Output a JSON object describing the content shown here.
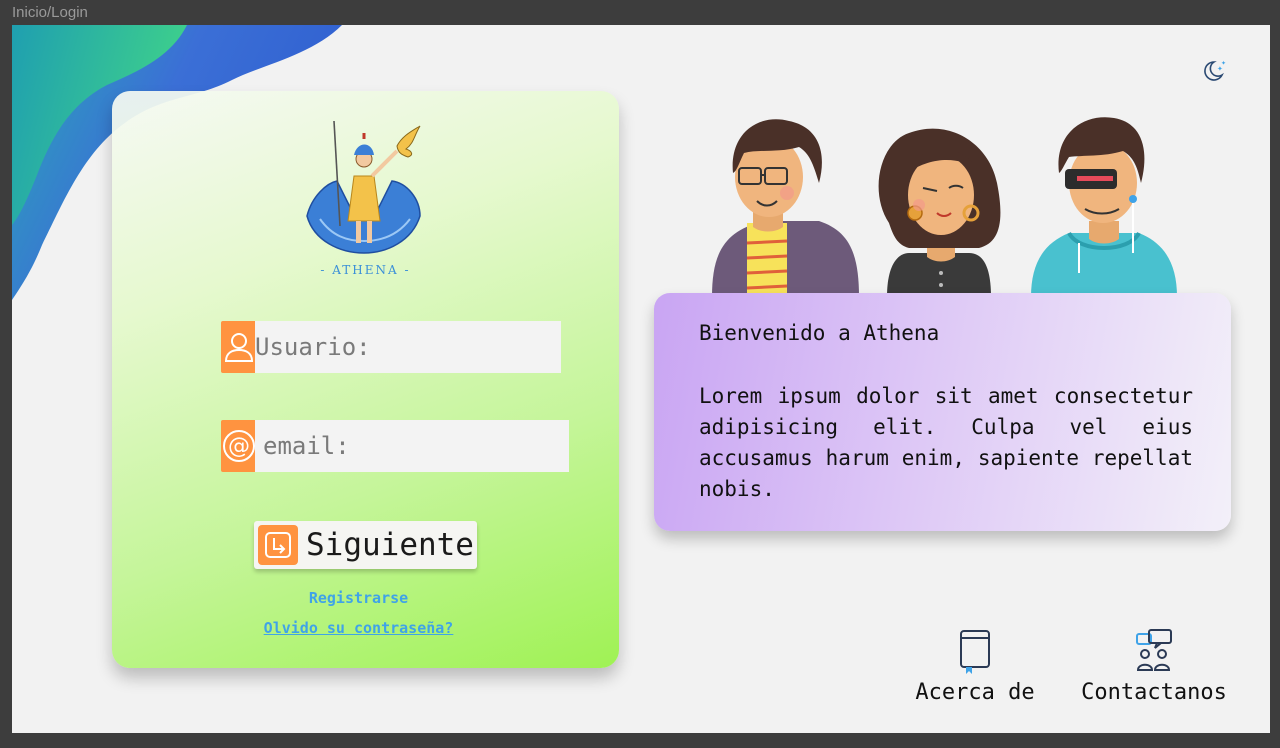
{
  "window": {
    "title": "Inicio/Login"
  },
  "brand": {
    "name": "- ATHENA -"
  },
  "login": {
    "username_placeholder": "Usuario:",
    "email_placeholder": "email:",
    "next_label": "Siguiente",
    "register_link": "Registrarse",
    "forgot_link": "Olvido su contraseña?"
  },
  "welcome": {
    "title": "Bienvenido a Athena",
    "body": "Lorem ipsum dolor sit amet consectetur adipisicing elit. Culpa vel eius accusamus harum enim, sapiente repellat nobis."
  },
  "nav": {
    "about_label": "Acerca de",
    "contact_label": "Contactanos"
  },
  "colors": {
    "accent_orange": "#ff9340",
    "link_blue": "#3fa3e8",
    "card_green": "#9ff254",
    "card_purple": "#c9a5f3"
  },
  "icons": {
    "theme": "moon-stars-icon",
    "user": "user-icon",
    "email": "at-icon",
    "next": "enter-icon",
    "about": "book-icon",
    "contact": "chat-users-icon"
  }
}
